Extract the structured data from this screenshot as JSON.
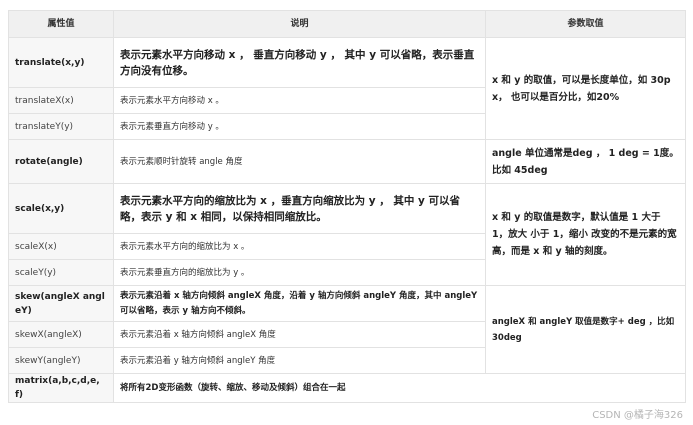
{
  "table": {
    "headers": [
      "属性值",
      "说明",
      "参数取值"
    ],
    "rows": [
      {
        "name": "translate(x,y)",
        "desc": "表示元素水平方向移动 x ， 垂直方向移动 y ， 其中 y 可以省略，表示垂直方向没有位移。",
        "param": "x 和 y 的取值，可以是长度单位，如 30px， 也可以是百分比，如20%"
      },
      {
        "name": "translateX(x)",
        "desc": "表示元素水平方向移动 x 。"
      },
      {
        "name": "translateY(y)",
        "desc": "表示元素垂直方向移动 y 。"
      },
      {
        "name": "rotate(angle)",
        "desc": "表示元素顺时针旋转 angle 角度",
        "param": "angle 单位通常是deg ， 1 deg = 1度。比如 45deg"
      },
      {
        "name": "scale(x,y)",
        "desc": "表示元素水平方向的缩放比为 x ，垂直方向缩放比为 y ， 其中 y 可以省略，表示 y 和 x 相同，以保持相同缩放比。",
        "param": "x 和 y 的取值是数字，默认值是 1 大于 1，放大 小于 1，缩小 改变的不是元素的宽高，而是 x 和 y 轴的刻度。"
      },
      {
        "name": "scaleX(x)",
        "desc": "表示元素水平方向的缩放比为 x 。"
      },
      {
        "name": "scaleY(y)",
        "desc": "表示元素垂直方向的缩放比为 y 。"
      },
      {
        "name": "skew(angleX angleY)",
        "desc": "表示元素沿着 x 轴方向倾斜 angleX 角度，沿着 y 轴方向倾斜 angleY 角度，其中 angleY 可以省略，表示 y 轴方向不倾斜。",
        "param": "angleX 和 angleY 取值是数字+ deg ，比如 30deg"
      },
      {
        "name": "skewX(angleX)",
        "desc": "表示元素沿着 x 轴方向倾斜 angleX 角度"
      },
      {
        "name": "skewY(angleY)",
        "desc": "表示元素沿着 y 轴方向倾斜 angleY 角度"
      },
      {
        "name": "matrix(a,b,c,d,e,f)",
        "desc": "将所有2D变形函数（旋转、缩放、移动及倾斜）组合在一起"
      }
    ]
  },
  "watermark": "CSDN @橘子海326"
}
